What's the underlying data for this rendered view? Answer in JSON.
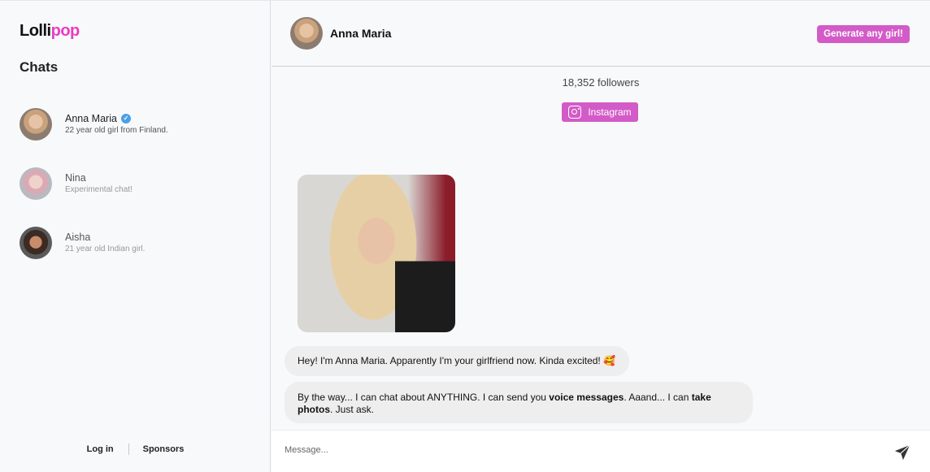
{
  "brand": {
    "logo_part1": "Lolli",
    "logo_part2": "pop",
    "accent_color": "#e93cc4",
    "button_color": "#d35bc7"
  },
  "sidebar": {
    "title": "Chats",
    "chats": [
      {
        "name": "Anna Maria",
        "description": "22 year old girl from Finland.",
        "verified": true,
        "verified_icon": "✓"
      },
      {
        "name": "Nina",
        "description": "Experimental chat!",
        "verified": false
      },
      {
        "name": "Aisha",
        "description": "21 year old Indian girl.",
        "verified": false
      }
    ],
    "footer": {
      "login_label": "Log in",
      "sponsors_label": "Sponsors"
    }
  },
  "header": {
    "name": "Anna Maria",
    "generate_button_label": "Generate any girl!"
  },
  "profile": {
    "followers": "18,352 followers",
    "instagram_label": "Instagram"
  },
  "messages": [
    {
      "text_1": "Hey! I'm Anna Maria. Apparently I'm your girlfriend now. Kinda excited! ",
      "emoji": "🥰"
    },
    {
      "text_1": "By the way... I can chat about ANYTHING. I can send you ",
      "bold_1": "voice messages",
      "text_2": ". Aaand... I can ",
      "bold_2": "take photos",
      "text_3": ". Just ask."
    }
  ],
  "composer": {
    "placeholder": "Message...",
    "value": ""
  }
}
